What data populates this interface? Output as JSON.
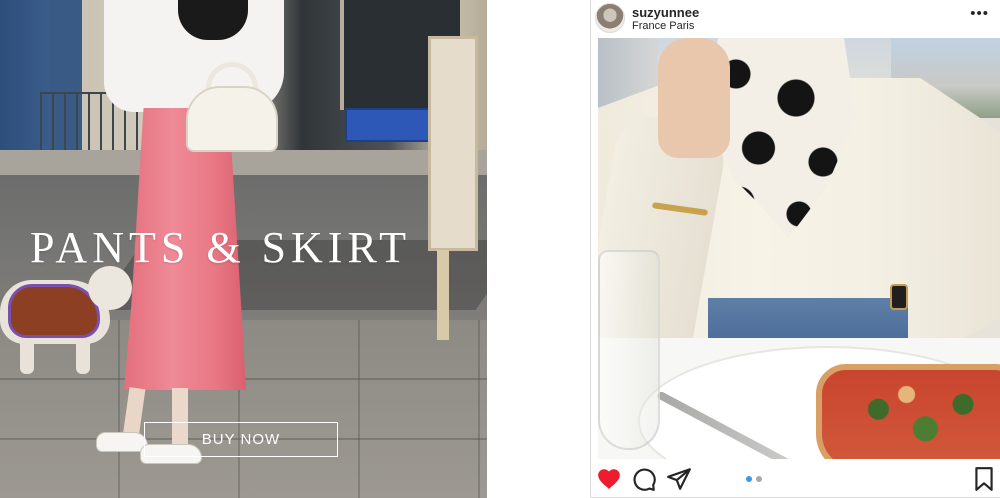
{
  "banner": {
    "title": "PANTS & SKIRT",
    "button_label": "BUY NOW"
  },
  "instagram_post": {
    "username": "suzyunnee",
    "location": "France Paris",
    "more_glyph": "•••",
    "carousel": {
      "total": 2,
      "active": 1
    },
    "icons": {
      "like": "heart-icon",
      "comment": "comment-icon",
      "share": "share-icon",
      "save": "bookmark-icon",
      "more": "more-icon"
    },
    "colors": {
      "like": "#ed1d2f",
      "active_dot": "#3897f0",
      "inactive_dot": "#a8a8a8",
      "text": "#262626"
    }
  }
}
